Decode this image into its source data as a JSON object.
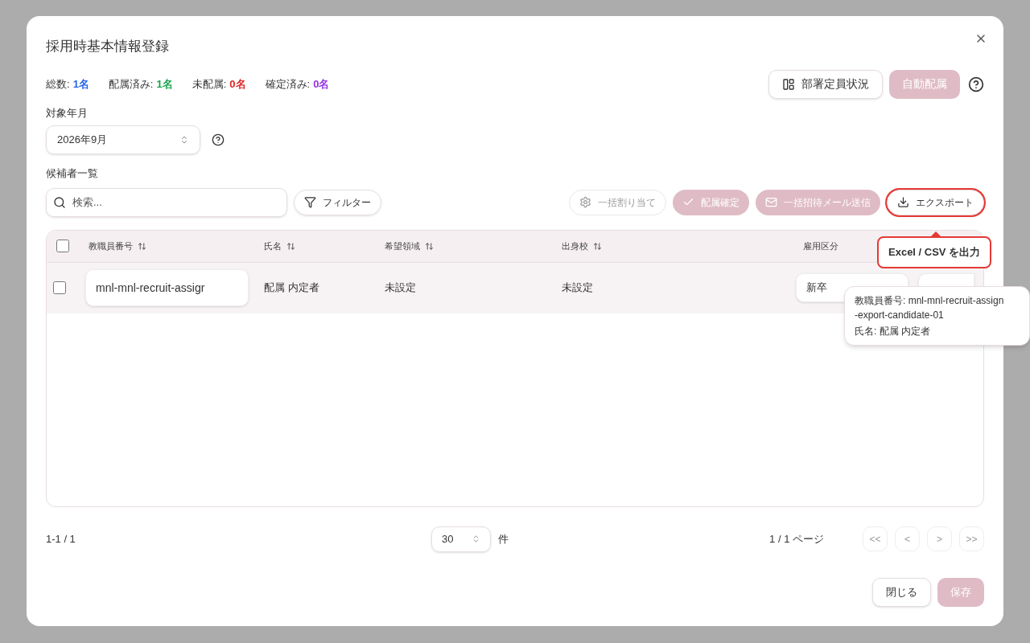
{
  "dialog": {
    "title": "採用時基本情報登録"
  },
  "stats": [
    {
      "label": "総数:",
      "value": "1名",
      "color": "#2563eb"
    },
    {
      "label": "配属済み:",
      "value": "1名",
      "color": "#16a34a"
    },
    {
      "label": "未配属:",
      "value": "0名",
      "color": "#dc2626"
    },
    {
      "label": "確定済み:",
      "value": "0名",
      "color": "#9333ea"
    }
  ],
  "header_buttons": [
    {
      "label": "部署定員状況",
      "kind": "outline",
      "disabled": false
    },
    {
      "label": "自動配属",
      "kind": "primary",
      "disabled": true
    }
  ],
  "period": {
    "label": "対象年月",
    "value": "2026年9月"
  },
  "list_title": "候補者一覧",
  "search": {
    "placeholder": "検索..."
  },
  "filter_button": "フィルター",
  "toolbar_buttons": [
    {
      "label": "一括割り当て",
      "kind": "outline",
      "disabled": true,
      "highlighted": false
    },
    {
      "label": "配属確定",
      "kind": "primary",
      "disabled": true,
      "highlighted": false
    },
    {
      "label": "一括招待メール送信",
      "kind": "primary",
      "disabled": true,
      "highlighted": false
    },
    {
      "label": "エクスポート",
      "kind": "outline",
      "disabled": false,
      "highlighted": true
    }
  ],
  "export_tooltip": "Excel / CSV を出力",
  "table": {
    "select_all": {
      "checked": false
    },
    "columns": [
      {
        "label": "教職員番号",
        "sortable": true
      },
      {
        "label": "氏名",
        "sortable": true
      },
      {
        "label": "希望領域",
        "sortable": true
      },
      {
        "label": "出身校",
        "sortable": true
      },
      {
        "label": "雇用区分",
        "sortable": false
      }
    ],
    "rows": [
      {
        "checked": false,
        "staff_number": "mnl-mnl-recruit-assigr",
        "name": "配属 内定者",
        "region": "未設定",
        "school": "未設定",
        "employment": "新卒"
      }
    ]
  },
  "row_tooltip": {
    "lines": [
      "教職員番号: mnl-mnl-recruit-assign",
      "-export-candidate-01",
      "氏名: 配属 内定者"
    ]
  },
  "pagination": {
    "range": "1-1 / 1",
    "page_size": "30",
    "page_size_unit": "件",
    "page": "1 / 1 ページ",
    "nav": [
      "<<",
      "<",
      ">",
      ">>"
    ]
  },
  "footer_buttons": [
    {
      "label": "閉じる",
      "kind": "outline",
      "disabled": false
    },
    {
      "label": "保存",
      "kind": "primary",
      "disabled": true
    }
  ]
}
